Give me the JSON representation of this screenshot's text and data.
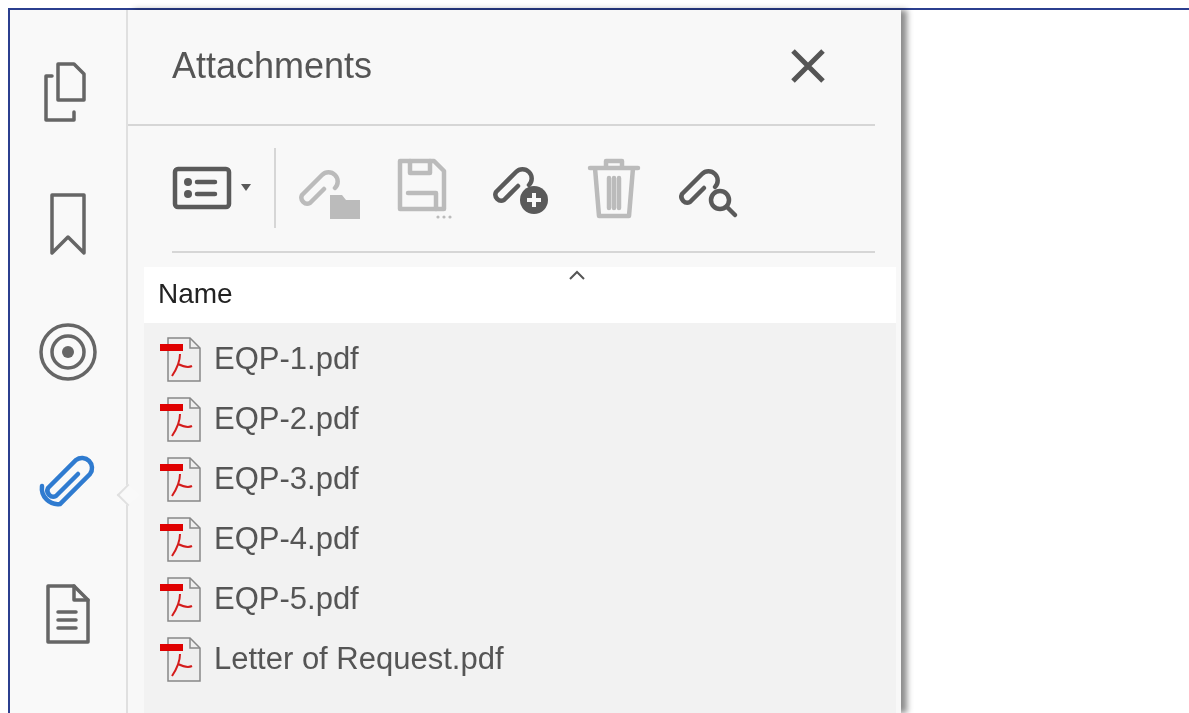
{
  "rail": [
    {
      "kind": "pages",
      "selected": false
    },
    {
      "kind": "bookmark",
      "selected": false
    },
    {
      "kind": "layers",
      "selected": false
    },
    {
      "kind": "attachment",
      "selected": true
    },
    {
      "kind": "document",
      "selected": false
    }
  ],
  "panel": {
    "title": "Attachments",
    "toolbar": [
      {
        "kind": "view",
        "disabled": false
      },
      {
        "kind": "open",
        "disabled": true
      },
      {
        "kind": "save",
        "disabled": true
      },
      {
        "kind": "add",
        "disabled": false
      },
      {
        "kind": "delete",
        "disabled": true
      },
      {
        "kind": "search",
        "disabled": false
      }
    ],
    "column": "Name",
    "files": [
      {
        "name": "EQP-1.pdf"
      },
      {
        "name": "EQP-2.pdf"
      },
      {
        "name": "EQP-3.pdf"
      },
      {
        "name": "EQP-4.pdf"
      },
      {
        "name": "EQP-5.pdf"
      },
      {
        "name": "Letter of Request.pdf"
      }
    ]
  }
}
